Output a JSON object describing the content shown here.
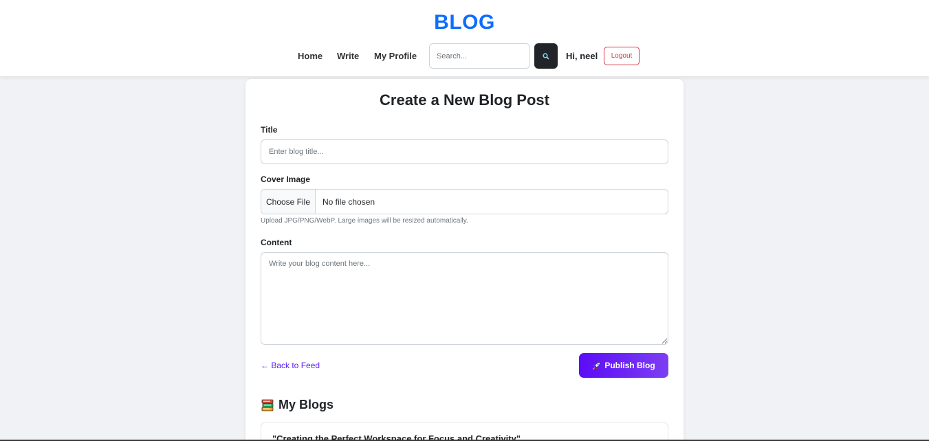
{
  "header": {
    "brand": "BLOG",
    "nav": {
      "home": "Home",
      "write": "Write",
      "profile": "My Profile"
    },
    "search": {
      "placeholder": "Search..."
    },
    "greeting": "Hi, neel",
    "logout_label": "Logout"
  },
  "form": {
    "heading": "Create a New Blog Post",
    "title_label": "Title",
    "title_placeholder": "Enter blog title...",
    "cover_label": "Cover Image",
    "choose_file_label": "Choose File",
    "file_status": "No file chosen",
    "cover_help": "Upload JPG/PNG/WebP. Large images will be resized automatically.",
    "content_label": "Content",
    "content_placeholder": "Write your blog content here...",
    "back_link": "← Back to Feed",
    "publish_label": "Publish Blog"
  },
  "my_blogs": {
    "heading": "My Blogs",
    "items": [
      {
        "title": "\"Creating the Perfect Workspace for Focus and Creativity\""
      }
    ]
  },
  "colors": {
    "brand": "#0d6efd",
    "publish_start": "#5b0cf7",
    "publish_end": "#7c3ff2",
    "logout": "#dc3545",
    "link": "#5b21f5"
  }
}
